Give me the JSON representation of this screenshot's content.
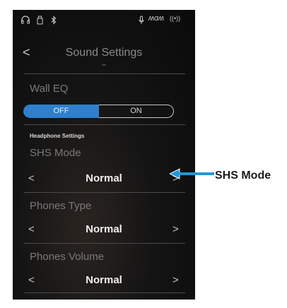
{
  "statusbar": {
    "icons": [
      "headphones-icon",
      "usb-icon",
      "bluetooth-icon",
      "microphone-icon",
      "wave-icon",
      "wireless-icon"
    ],
    "wave_label": "ʍɑʍ",
    "wireless_label": "((•))"
  },
  "nav": {
    "back_label": "<",
    "title": "Sound Settings"
  },
  "wall_eq": {
    "label": "Wall EQ",
    "off_label": "OFF",
    "on_label": "ON",
    "selected": "OFF"
  },
  "section": {
    "header": "Headphone Settings"
  },
  "settings": [
    {
      "label": "SHS Mode",
      "value": "Normal"
    },
    {
      "label": "Phones Type",
      "value": "Normal"
    },
    {
      "label": "Phones Volume",
      "value": "Normal"
    }
  ],
  "arrows": {
    "left": "<",
    "right": ">"
  },
  "callout": {
    "label": "SHS Mode",
    "color": "#1e9ad6"
  },
  "colors": {
    "accent": "#2f7fcc",
    "background": "#0d0d0d"
  }
}
